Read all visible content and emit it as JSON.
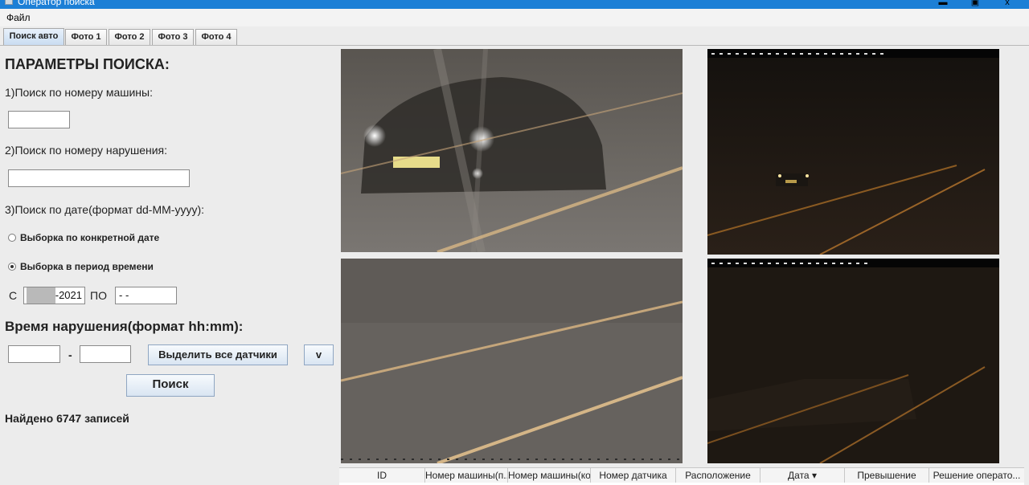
{
  "window": {
    "title": "Оператор поиска",
    "minimize": "▬",
    "maximize": "▣",
    "close": "x"
  },
  "menu": {
    "file": "Файл"
  },
  "tabs": [
    "Поиск авто",
    "Фото 1",
    "Фото 2",
    "Фото 3",
    "Фото 4"
  ],
  "search": {
    "heading": "ПАРАМЕТРЫ ПОИСКА:",
    "by_plate_label": "1)Поиск по номеру машины:",
    "by_plate_value": "",
    "by_violation_label": "2)Поиск по номеру нарушения:",
    "by_violation_value": "",
    "by_date_label": "3)Поиск по дате(формат dd-MM-yyyy):",
    "radio_specific_date": "Выборка по конкретной дате",
    "radio_period": "Выборка в период времени",
    "from_label": "С",
    "from_value": "-2021",
    "to_label": "ПО",
    "to_value": " -  -",
    "time_heading": "Время нарушения(формат hh:mm):",
    "time_from": "",
    "time_dash": "-",
    "time_to": "",
    "select_all_sensors": "Выделить все датчики",
    "dropdown_arrow": "v",
    "search_button": "Поиск",
    "result": "Найдено 6747 записей"
  },
  "table": {
    "columns": [
      "ID",
      "Номер машины(п...",
      "Номер машины(ко...",
      "Номер датчика",
      "Расположение",
      "Дата ▾",
      "Превышение",
      "Решение операто..."
    ]
  },
  "colors": {
    "titlebar": "#1c7fd6",
    "tab_active": "#c9dcf1",
    "photo_gray": "#6e6a66",
    "photo_dark": "#1f1a14"
  }
}
